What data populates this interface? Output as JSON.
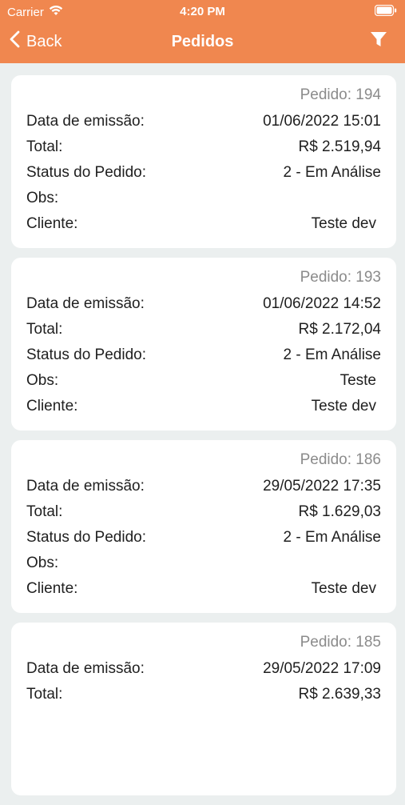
{
  "status_bar": {
    "carrier": "Carrier",
    "time": "4:20 PM"
  },
  "nav": {
    "back_label": "Back",
    "title": "Pedidos"
  },
  "labels": {
    "data": "Data de emissão:",
    "total": "Total:",
    "status": "Status do Pedido:",
    "obs": "Obs:",
    "cliente": "Cliente:"
  },
  "orders": [
    {
      "pedido": "Pedido: 194",
      "data": "01/06/2022 15:01",
      "total": "R$ 2.519,94",
      "status": "2 - Em Análise",
      "obs": "",
      "cliente": "Teste dev"
    },
    {
      "pedido": "Pedido: 193",
      "data": "01/06/2022 14:52",
      "total": "R$ 2.172,04",
      "status": "2 - Em Análise",
      "obs": "Teste",
      "cliente": "Teste dev"
    },
    {
      "pedido": "Pedido: 186",
      "data": "29/05/2022 17:35",
      "total": "R$ 1.629,03",
      "status": "2 - Em Análise",
      "obs": "",
      "cliente": "Teste dev"
    },
    {
      "pedido": "Pedido: 185",
      "data": "29/05/2022 17:09",
      "total": "R$ 2.639,33",
      "status": "",
      "obs": "",
      "cliente": ""
    }
  ],
  "colors": {
    "accent": "#F0874F",
    "background": "#EBEFEF",
    "card": "#FFFFFF",
    "muted": "#8B8B8B"
  },
  "icons": {
    "wifi": "wifi-icon",
    "battery": "battery-icon",
    "back": "chevron-left-icon",
    "filter": "filter-icon"
  }
}
